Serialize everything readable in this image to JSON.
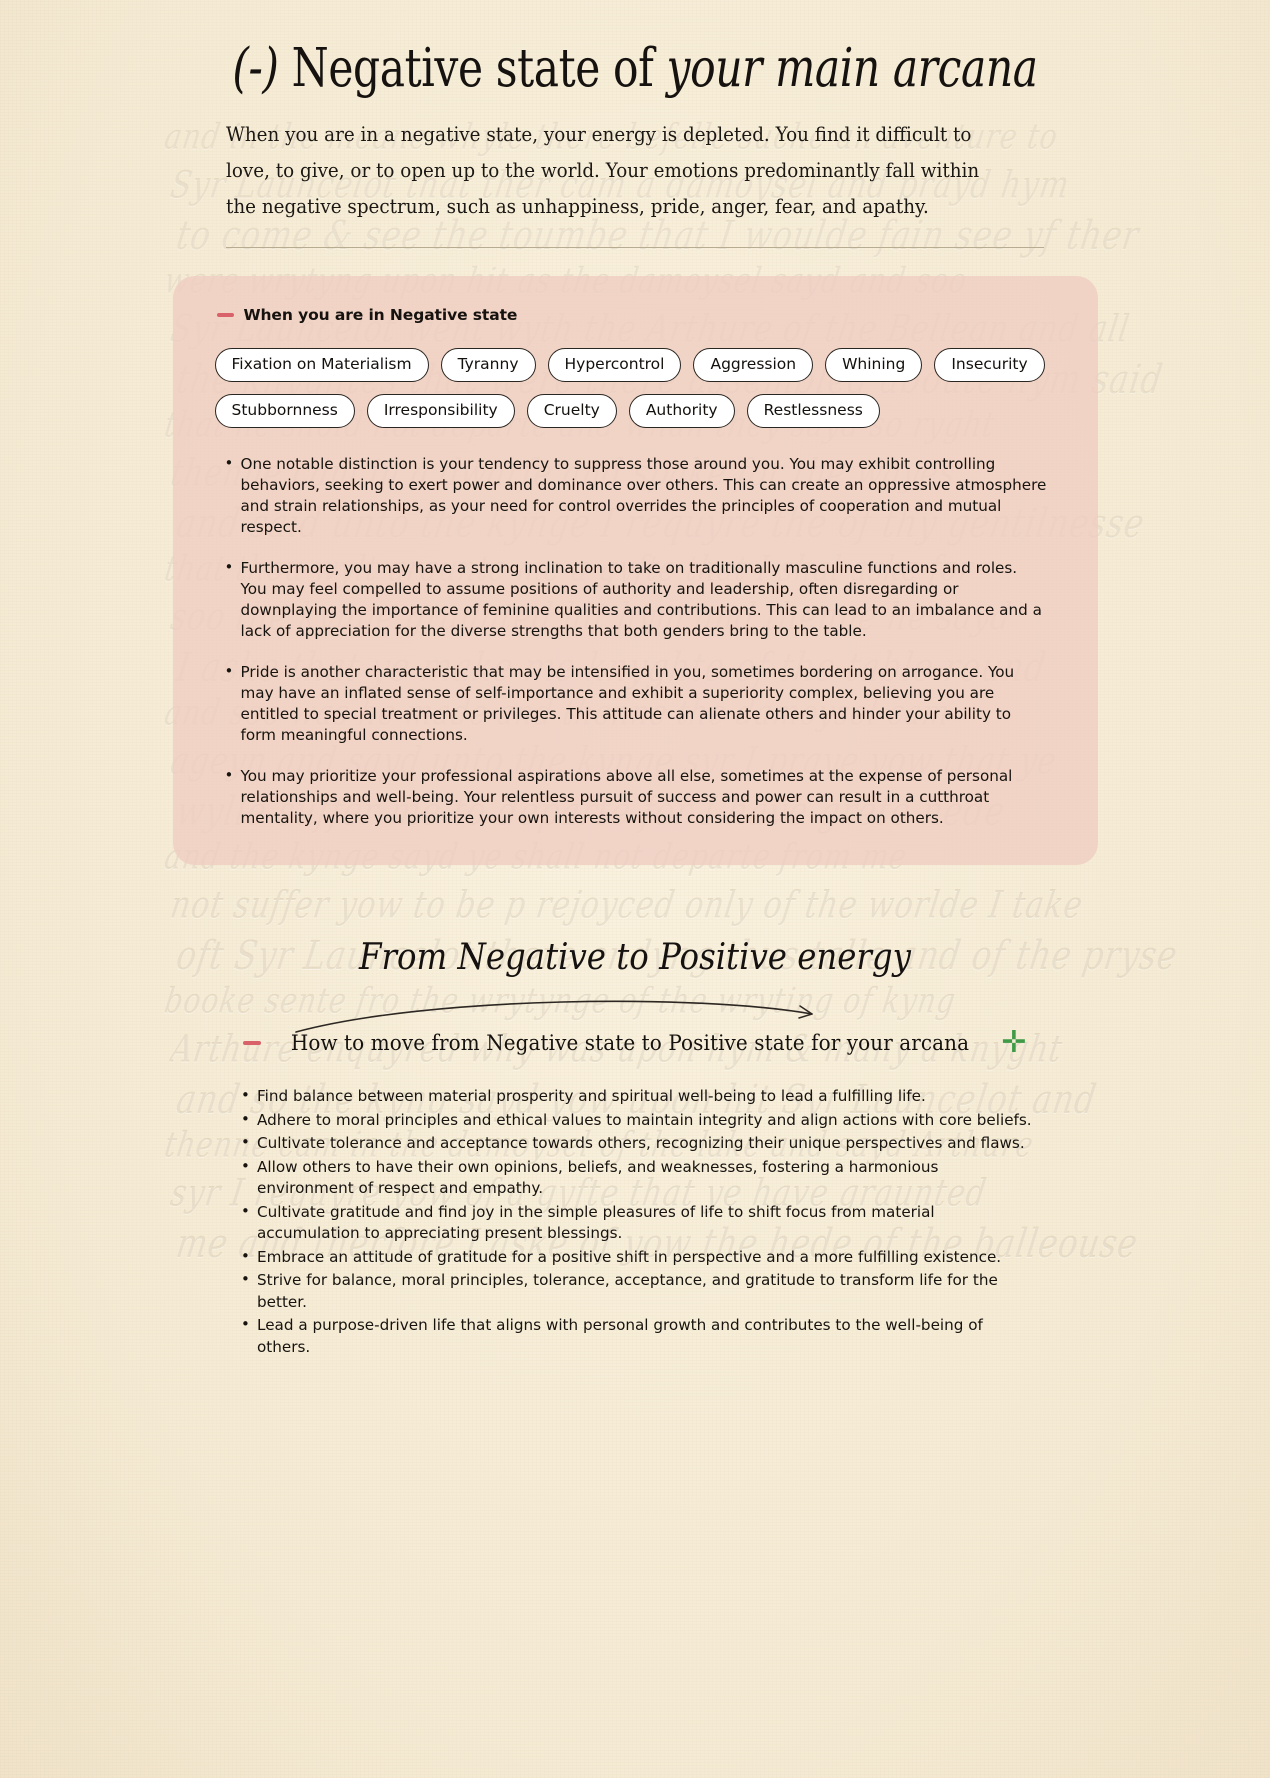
{
  "title": {
    "sign": "(-)",
    "lead": " Negative state of ",
    "emphasis": "your main arcana"
  },
  "intro": "When you are in a negative state, your energy is depleted. You find it difficult to love, to give, or to open up to the world. Your emotions predominantly fall within the negative spectrum, such as unhappiness, pride, anger, fear, and apathy.",
  "negative_card": {
    "heading": "When you are in Negative state",
    "accent_color": "#d9616a",
    "card_color": "#efcdc1",
    "tags_row_1": [
      "Fixation on Materialism",
      "Tyranny",
      "Hypercontrol",
      "Aggression",
      "Whining",
      "Insecurity"
    ],
    "tags_row_2": [
      "Stubbornness",
      "Irresponsibility",
      "Cruelty",
      "Authority",
      "Restlessness"
    ],
    "bullets": [
      "One notable distinction is your tendency to suppress those around you. You may exhibit controlling behaviors, seeking to exert power and dominance over others. This can create an oppressive atmosphere and strain relationships, as your need for control overrides the principles of cooperation and mutual respect.",
      "Furthermore, you may have a strong inclination to take on traditionally masculine functions and roles. You may feel compelled to assume positions of authority and leadership, often disregarding or downplaying the importance of feminine qualities and contributions. This can lead to an imbalance and a lack of appreciation for the diverse strengths that both genders bring to the table.",
      "Pride is another characteristic that may be intensified in you, sometimes bordering on arrogance. You may have an inflated sense of self-importance and exhibit a superiority complex, believing you are entitled to special treatment or privileges. This attitude can alienate others and hinder your ability to form meaningful connections.",
      "You may prioritize your professional aspirations above all else, sometimes at the expense of personal relationships and well-being. Your relentless pursuit of success and power can result in a cutthroat mentality, where you prioritize your own interests without considering the impact on others."
    ]
  },
  "transition": {
    "title": "From Negative to Positive energy",
    "howto_label": "How to move from Negative state to Positive state for your arcana",
    "plus_symbol": "✛",
    "plus_color": "#3f9b47",
    "dash_color": "#d9616a",
    "bullets": [
      "Find balance between material prosperity and spiritual well-being to lead a fulfilling life.",
      "Adhere to moral principles and ethical values to maintain integrity and align actions with core beliefs.",
      "Cultivate tolerance and acceptance towards others, recognizing their unique perspectives and flaws.",
      "Allow others to have their own opinions, beliefs, and weaknesses, fostering a harmonious environment of respect and empathy.",
      "Cultivate gratitude and find joy in the simple pleasures of life to shift focus from material accumulation to appreciating present blessings.",
      "Embrace an attitude of gratitude for a positive shift in perspective and a more fulfilling existence.",
      "Strive for balance, moral principles, tolerance, acceptance, and gratitude to transform life for the better.",
      "Lead a purpose-driven life that aligns with personal growth and contributes to the well-being of others."
    ]
  },
  "background": {
    "paper_color": "#f7eed9",
    "manuscript_lines": [
      "and in the meane whyle there befelle suche an aventure to",
      "Syr Launcelot that ther cam a damoysel and prayd hym",
      "to come & see the toumbe that I woulde fain see yf ther",
      "were wrytyng upon hit as the damoysel sayd and soo",
      "Syr Launcelot went wyth the Arthure of the Bellean and all",
      "the knyghtes that were there assembled aboute hym said",
      "that he shold not departe and whan they sayd so ryght",
      "thenne cam in a dwarfe and spake for the wayes",
      "and said unto the kynge I requyre the of thy gentilnesse",
      "that thou wylt graunte me a gyfte that I shal aske for",
      "soo the kynge graunted hit hym and thenne he sayd",
      "I aske that ye make me knyghte of the table round",
      "and soo was he made and thenne the damoysel cam",
      "ageyn and sayd unto the kynge syr I praye yow that ye",
      "wylle suffer me to departe for I have grete nede",
      "and the kynge sayd ye shall not departe from me",
      "not suffer yow to be p rejoyced only of the worlde I take",
      "oft Syr Launcelot there endyng thus talle and of the pryse",
      "booke sente fro the wrytynge of the wryting of kyng",
      "Arthure enquyred why was upon hym & many a knyght",
      "and so the kyng sayd yow upon hit Syr Launcelot and",
      "thenne cam in the damoysel of the lake and sayd Arthure",
      "syr I requyre yow of a gyfte that ye have graunted",
      "me and therfore I aske of yow the hede of the balleouse"
    ]
  }
}
